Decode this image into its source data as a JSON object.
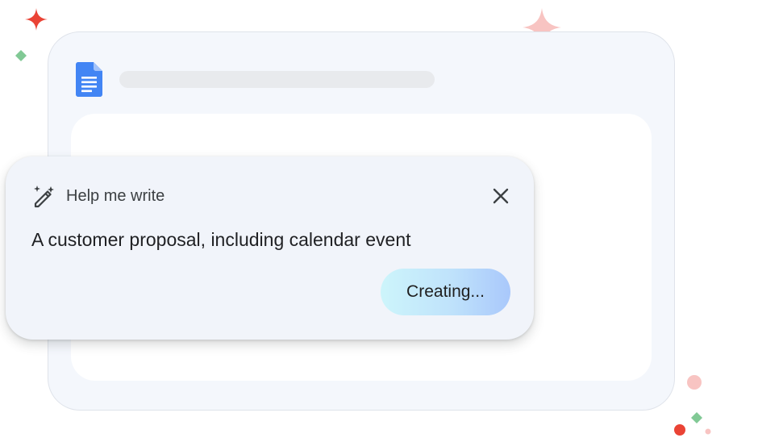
{
  "card": {
    "title": "Help me write",
    "prompt": "A customer proposal, including calendar event",
    "button_label": "Creating..."
  },
  "icons": {
    "docs": "google-docs-icon",
    "wand": "magic-wand-icon",
    "close": "close-icon"
  },
  "colors": {
    "docs_blue": "#4285f4",
    "sparkle_red": "#ea4335",
    "sparkle_pink": "#f8c4c2",
    "sparkle_yellow": "#fbbc04",
    "sparkle_green": "#81c995",
    "button_gradient_start": "#cdf5fb",
    "button_gradient_end": "#a9c8fb"
  }
}
